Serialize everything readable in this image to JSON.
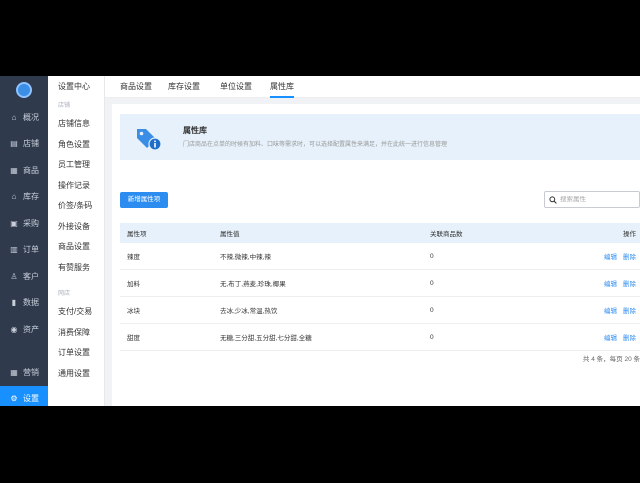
{
  "sidebar": {
    "items": [
      {
        "label": "概况",
        "icon": "home-icon",
        "glyph": "⌂"
      },
      {
        "label": "店铺",
        "icon": "store-icon",
        "glyph": "▤"
      },
      {
        "label": "商品",
        "icon": "goods-icon",
        "glyph": "▦"
      },
      {
        "label": "库存",
        "icon": "inventory-icon",
        "glyph": "⌂"
      },
      {
        "label": "采购",
        "icon": "purchase-icon",
        "glyph": "▣"
      },
      {
        "label": "订单",
        "icon": "order-icon",
        "glyph": "▥"
      },
      {
        "label": "客户",
        "icon": "customer-icon",
        "glyph": "♙"
      },
      {
        "label": "数据",
        "icon": "data-icon",
        "glyph": "▮"
      },
      {
        "label": "资产",
        "icon": "asset-icon",
        "glyph": "◉"
      }
    ],
    "bottom_items": [
      {
        "label": "营销",
        "icon": "marketing-icon",
        "glyph": "▦"
      },
      {
        "label": "设置",
        "icon": "settings-icon",
        "glyph": "⚙",
        "active": true
      }
    ]
  },
  "submenu": {
    "title": "设置中心",
    "group1": "店铺",
    "group1_items": [
      "店铺信息",
      "角色设置",
      "员工管理",
      "操作记录",
      "价签/条码",
      "外接设备",
      "商品设置",
      "有赞服务"
    ],
    "group2": "网店",
    "group2_items": [
      "支付/交易",
      "消费保障",
      "订单设置",
      "通用设置"
    ]
  },
  "tabs": [
    "商品设置",
    "库存设置",
    "单位设置",
    "属性库"
  ],
  "banner": {
    "title": "属性库",
    "description": "门店商品在点单的时候有加料、口味等需求时，可以选择配置属性来满足，并在此统一进行信息管理"
  },
  "toolbar": {
    "add_label": "新增属性项",
    "search_placeholder": "搜索属性"
  },
  "table": {
    "headers": [
      "属性项",
      "属性值",
      "关联商品数",
      "操作"
    ],
    "rows": [
      {
        "name": "辣度",
        "values": "不辣,微辣,中辣,辣",
        "count": "0",
        "edit": "编辑",
        "delete": "删除"
      },
      {
        "name": "加料",
        "values": "无,布丁,燕麦,珍珠,椰果",
        "count": "0",
        "edit": "编辑",
        "delete": "删除"
      },
      {
        "name": "冰块",
        "values": "去冰,少冰,常温,热饮",
        "count": "0",
        "edit": "编辑",
        "delete": "删除"
      },
      {
        "name": "甜度",
        "values": "无糖,三分甜,五分甜,七分甜,全糖",
        "count": "0",
        "edit": "编辑",
        "delete": "删除"
      }
    ]
  },
  "pagination": "共 4 条，每页 20 条",
  "colors": {
    "accent": "#2d8cf0",
    "sidebar": "#2f3a4c",
    "banner": "#e6f1fb"
  }
}
